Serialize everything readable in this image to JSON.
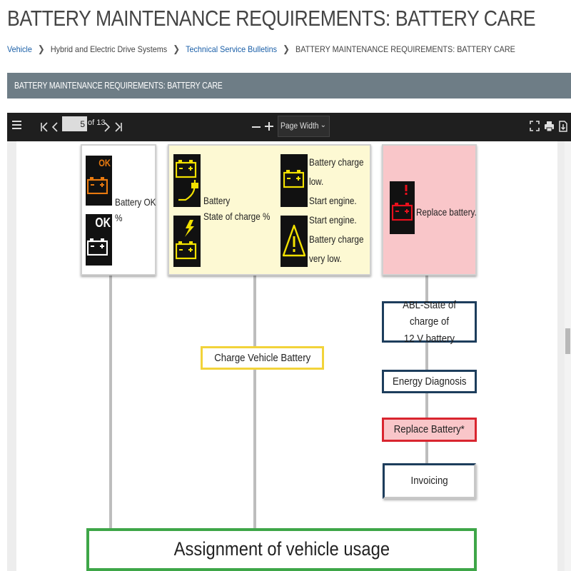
{
  "page": {
    "title": "BATTERY MAINTENANCE REQUIREMENTS: BATTERY CARE"
  },
  "breadcrumb": {
    "items": [
      {
        "label": "Vehicle",
        "link": true
      },
      {
        "label": "Hybrid and Electric Drive Systems",
        "link": false
      },
      {
        "label": "Technical Service Bulletins",
        "link": true
      },
      {
        "label": "BATTERY MAINTENANCE REQUIREMENTS: BATTERY CARE",
        "link": false
      }
    ],
    "separator_icon": "chevron-right-icon"
  },
  "section": {
    "heading": "BATTERY MAINTENANCE REQUIREMENTS: BATTERY CARE"
  },
  "toolbar": {
    "menu_icon": "sidebar-toggle-icon",
    "first_page_icon": "first-page-icon",
    "prev_page_icon": "previous-page-icon",
    "current_page": "5",
    "page_count_text": "of 13",
    "next_page_icon": "next-page-icon",
    "last_page_icon": "last-page-icon",
    "zoom_out_icon": "zoom-out-icon",
    "zoom_in_icon": "zoom-in-icon",
    "zoom_value": "Page Width",
    "zoom_options": [
      "Page Width"
    ],
    "fullscreen_icon": "fullscreen-icon",
    "print_icon": "print-icon",
    "download_icon": "download-icon"
  },
  "diagram": {
    "ok_box": {
      "label_line1": "Battery OK",
      "label_line2": "%",
      "icon_top_text": "OK",
      "icon_bottom_text": "OK"
    },
    "charge_box": {
      "battery_label_line1": "Battery",
      "battery_label_line2": "State of charge %",
      "low_label": [
        "Battery charge",
        "low.",
        "Start engine."
      ],
      "very_low_label": [
        "Start engine.",
        "Battery charge",
        "very low."
      ]
    },
    "replace_box": {
      "label": "Replace battery."
    },
    "charge_vehicle_battery": "Charge Vehicle Battery",
    "abl_state_of_charge": [
      "ABL-State of charge of",
      "12 V battery"
    ],
    "energy_diagnosis": "Energy Diagnosis",
    "replace_battery": "Replace Battery*",
    "invoicing": "Invoicing",
    "assignment": "Assignment of vehicle usage"
  },
  "colors": {
    "link": "#1a5fa8",
    "section_bar": "#6e7d86",
    "toolbar": "#1f1f1f",
    "charge_box_fill": "#fdf9d3",
    "replace_box_fill": "#f9c6c9",
    "yellow_border": "#f2d33a",
    "red_border": "#d9252f",
    "navy_border": "#1d3d5c",
    "green_border": "#3ea648",
    "icon_orange": "#e8790f",
    "icon_yellow": "#f2e100",
    "icon_red": "#e8101c"
  }
}
